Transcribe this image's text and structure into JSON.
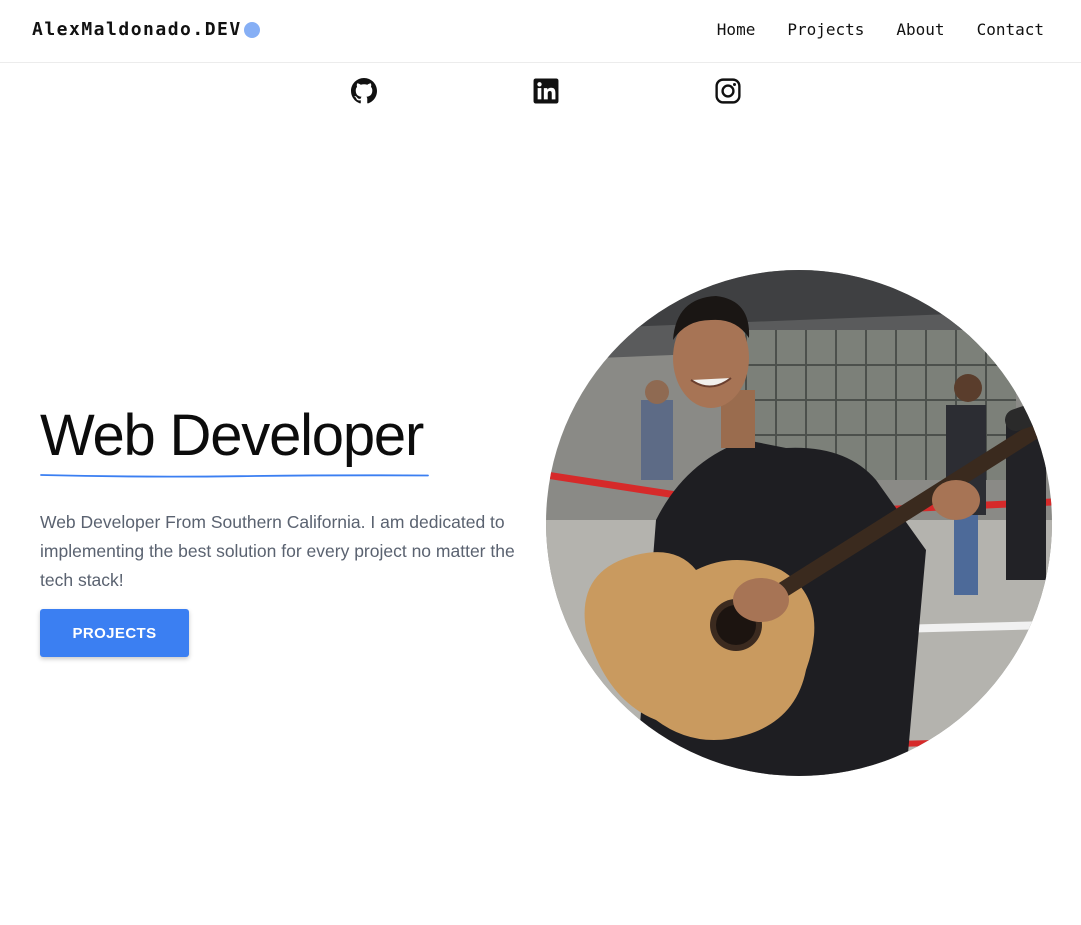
{
  "header": {
    "brand": "AlexMaldonado.DEV",
    "nav": [
      "Home",
      "Projects",
      "About",
      "Contact"
    ]
  },
  "social": {
    "icons": [
      "github-icon",
      "linkedin-icon",
      "instagram-icon"
    ]
  },
  "hero": {
    "title": "Web Developer",
    "description": "Web Developer From Southern California. I am dedicated to implementing the best solution for every project no matter the tech stack!",
    "button_label": "PROJECTS"
  },
  "colors": {
    "accent": "#3b7ff2",
    "brand_dot": "#86aff5",
    "body_text": "#5a6270"
  }
}
